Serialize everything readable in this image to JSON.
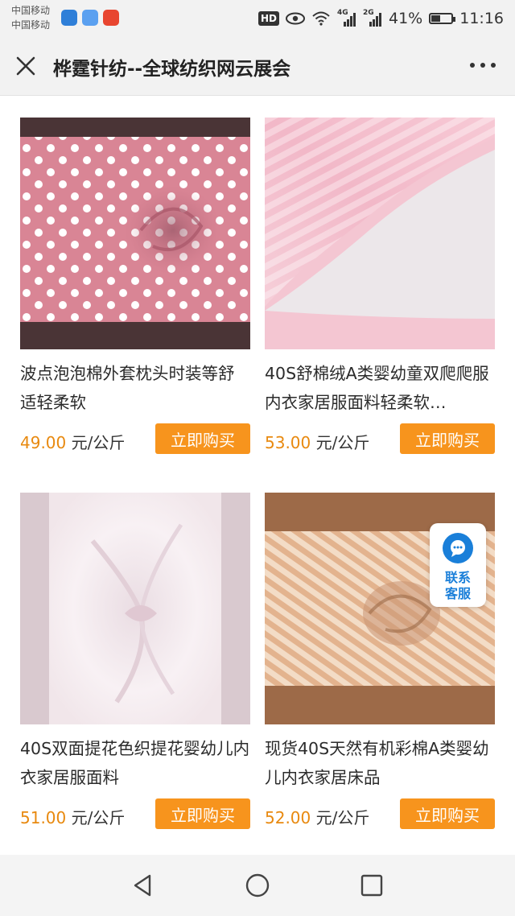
{
  "status_bar": {
    "carrier_1": "中国移动",
    "carrier_2": "中国移动",
    "app_icons": [
      "shield-app-icon",
      "music-app-icon",
      "shopping-app-icon"
    ],
    "hd_badge": "HD",
    "net_4g": "4G",
    "net_2g": "2G",
    "battery_percent": "41%",
    "battery_level": 0.41,
    "time": "11:16"
  },
  "header": {
    "title": "桦霆针纺--全球纺织网云展会"
  },
  "products": [
    {
      "name": "波点泡泡棉外套枕头时装等舒适轻柔软",
      "price": "49.00",
      "unit": "元/公斤",
      "buy_label": "立即购买"
    },
    {
      "name": "40S舒棉绒A类婴幼童双爬爬服内衣家居服面料轻柔软…",
      "price": "53.00",
      "unit": "元/公斤",
      "buy_label": "立即购买"
    },
    {
      "name": "40S双面提花色织提花婴幼儿内衣家居服面料",
      "price": "51.00",
      "unit": "元/公斤",
      "buy_label": "立即购买"
    },
    {
      "name": "现货40S天然有机彩棉A类婴幼儿内衣家居床品",
      "price": "52.00",
      "unit": "元/公斤",
      "buy_label": "立即购买"
    }
  ],
  "contact_widget": {
    "line_1": "联系",
    "line_2": "客服"
  },
  "colors": {
    "accent_orange": "#f7941d",
    "price_orange": "#e8890f",
    "contact_blue": "#1a7fd9"
  }
}
